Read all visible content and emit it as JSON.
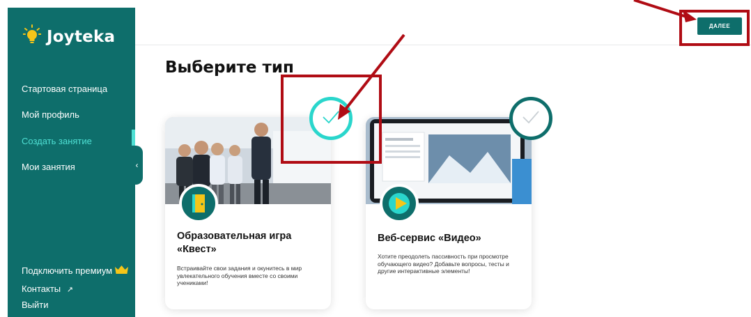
{
  "brand": {
    "name": "Joyteka"
  },
  "sidebar": {
    "items": [
      {
        "label": "Стартовая страница"
      },
      {
        "label": "Мой профиль"
      },
      {
        "label": "Создать занятие"
      },
      {
        "label": "Мои занятия"
      }
    ],
    "bottom": [
      {
        "label": "Подключить премиум"
      },
      {
        "label": "Контакты",
        "suffix": "↗"
      },
      {
        "label": "Выйти"
      }
    ]
  },
  "header": {
    "next_label": "ДАЛЕЕ"
  },
  "main": {
    "title": "Выберите тип",
    "cards": [
      {
        "title": "Образовательная игра «Квест»",
        "description": "Встраивайте свои задания и окунитесь в мир увлекательного обучения вместе со своими учениками!",
        "selected": true
      },
      {
        "title": "Веб-сервис «Видео»",
        "description": "Хотите преодолеть пассивность при просмотре обучающего видео? Добавьте вопросы, тесты и другие интерактивные элементы!",
        "selected": false
      }
    ]
  },
  "colors": {
    "brand_teal": "#0e6e6b",
    "accent_cyan": "#2ad6cc",
    "highlight_red": "#b00c14"
  },
  "icons": [
    "bulb-icon",
    "crown-icon",
    "external-link-icon",
    "chevron-left-icon",
    "check-icon",
    "door-icon",
    "play-icon"
  ]
}
